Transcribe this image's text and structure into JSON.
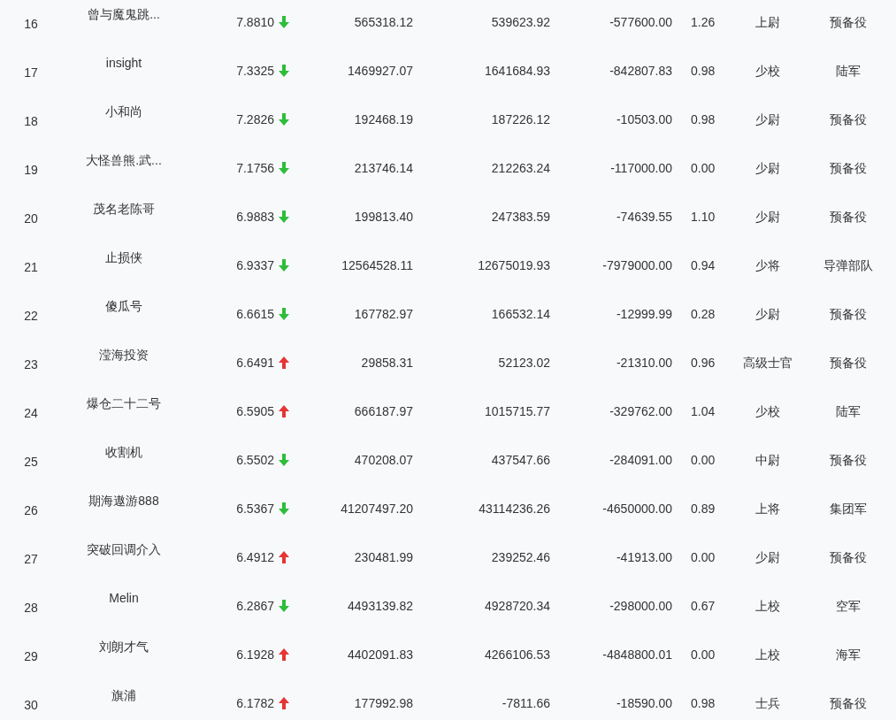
{
  "table": {
    "rows": [
      {
        "cells": [
          "16",
          "曾与魔鬼跳...",
          "7.8810",
          "565318.12",
          "539623.92",
          "-577600.00",
          "1.26",
          "上尉",
          "预备役"
        ],
        "rising": false
      },
      {
        "cells": [
          "17",
          "insight",
          "7.3325",
          "1469927.07",
          "1641684.93",
          "-842807.83",
          "0.98",
          "少校",
          "陆军"
        ],
        "rising": false
      },
      {
        "cells": [
          "18",
          "小和尚",
          "7.2826",
          "192468.19",
          "187226.12",
          "-10503.00",
          "0.98",
          "少尉",
          "预备役"
        ],
        "rising": false
      },
      {
        "cells": [
          "19",
          "大怪兽熊.武...",
          "7.1756",
          "213746.14",
          "212263.24",
          "-117000.00",
          "0.00",
          "少尉",
          "预备役"
        ],
        "rising": false
      },
      {
        "cells": [
          "20",
          "茂名老陈哥",
          "6.9883",
          "199813.40",
          "247383.59",
          "-74639.55",
          "1.10",
          "少尉",
          "预备役"
        ],
        "rising": false
      },
      {
        "cells": [
          "21",
          "止损侠",
          "6.9337",
          "12564528.11",
          "12675019.93",
          "-7979000.00",
          "0.94",
          "少将",
          "导弹部队"
        ],
        "rising": false
      },
      {
        "cells": [
          "22",
          "傻瓜号",
          "6.6615",
          "167782.97",
          "166532.14",
          "-12999.99",
          "0.28",
          "少尉",
          "预备役"
        ],
        "rising": false
      },
      {
        "cells": [
          "23",
          "滢海投资",
          "6.6491",
          "29858.31",
          "52123.02",
          "-21310.00",
          "0.96",
          "高级士官",
          "预备役"
        ],
        "rising": true
      },
      {
        "cells": [
          "24",
          "爆仓二十二号",
          "6.5905",
          "666187.97",
          "1015715.77",
          "-329762.00",
          "1.04",
          "少校",
          "陆军"
        ],
        "rising": true
      },
      {
        "cells": [
          "25",
          "收割机",
          "6.5502",
          "470208.07",
          "437547.66",
          "-284091.00",
          "0.00",
          "中尉",
          "预备役"
        ],
        "rising": false
      },
      {
        "cells": [
          "26",
          "期海遨游888",
          "6.5367",
          "41207497.20",
          "43114236.26",
          "-4650000.00",
          "0.89",
          "上将",
          "集团军"
        ],
        "rising": false
      },
      {
        "cells": [
          "27",
          "突破回调介入",
          "6.4912",
          "230481.99",
          "239252.46",
          "-41913.00",
          "0.00",
          "少尉",
          "预备役"
        ],
        "rising": true
      },
      {
        "cells": [
          "28",
          "Melin",
          "6.2867",
          "4493139.82",
          "4928720.34",
          "-298000.00",
          "0.67",
          "上校",
          "空军"
        ],
        "rising": false
      },
      {
        "cells": [
          "29",
          "刘朗才气",
          "6.1928",
          "4402091.83",
          "4266106.53",
          "-4848800.01",
          "0.00",
          "上校",
          "海军"
        ],
        "rising": true
      },
      {
        "cells": [
          "30",
          "旗浦",
          "6.1782",
          "177992.98",
          "-7811.66",
          "-18590.00",
          "0.98",
          "士兵",
          "预备役"
        ],
        "rising": true
      }
    ]
  }
}
